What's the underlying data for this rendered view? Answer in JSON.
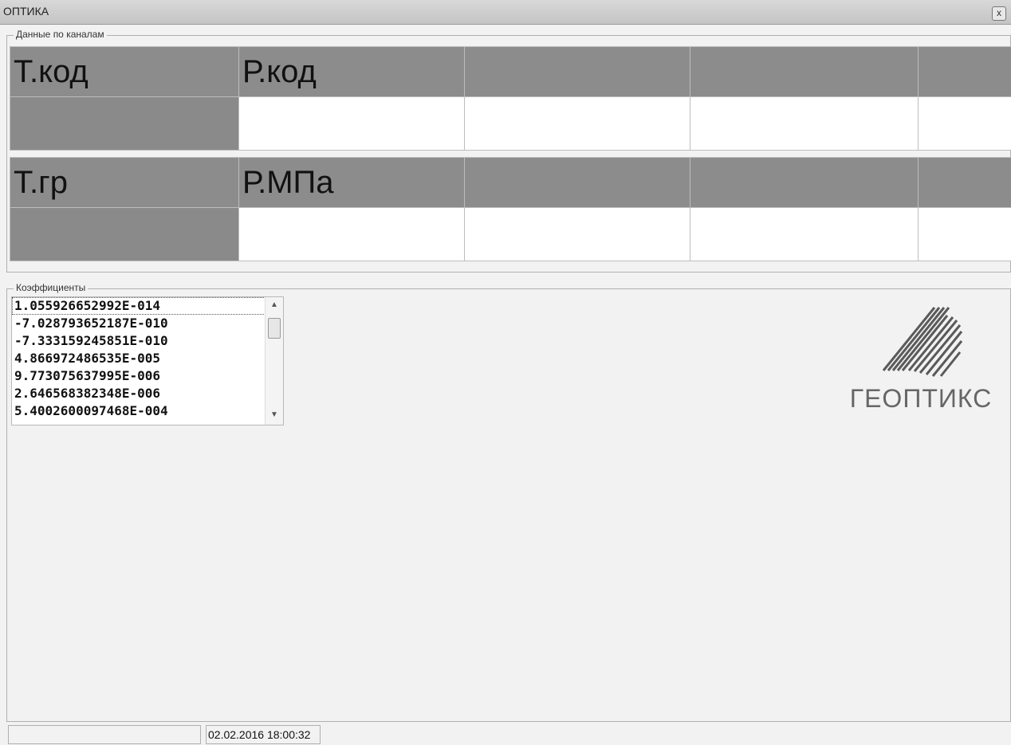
{
  "window": {
    "title": "ОПТИКА",
    "close_glyph": "x"
  },
  "channels": {
    "label": "Данные по каналам",
    "row1_headers": [
      "Т.код",
      "Р.код",
      "",
      "",
      ""
    ],
    "row1_values": [
      "",
      "",
      "",
      "",
      ""
    ],
    "row2_headers": [
      "Т.гр",
      "Р.МПа",
      "",
      "",
      ""
    ],
    "row2_values": [
      "",
      "",
      "",
      "",
      ""
    ]
  },
  "coefficients": {
    "label": "Коэффициенты",
    "items": [
      "1.055926652992E-014",
      "-7.028793652187E-010",
      "-7.333159245851E-010",
      "4.866972486535E-005",
      "9.773075637995E-006",
      "2.646568382348E-006",
      "5.4002600097468E-004"
    ],
    "selected_index": 0,
    "scroll_up_icon": "scroll-up-arrow",
    "scroll_down_icon": "scroll-down-arrow"
  },
  "logo": {
    "text": "ГЕОПТИКС",
    "icon": "geoptiks-logo"
  },
  "statusbar": {
    "left": "",
    "datetime": "02.02.2016 18:00:32"
  },
  "colors": {
    "header_gray": "#8c8c8c",
    "background": "#f2f2f2"
  }
}
